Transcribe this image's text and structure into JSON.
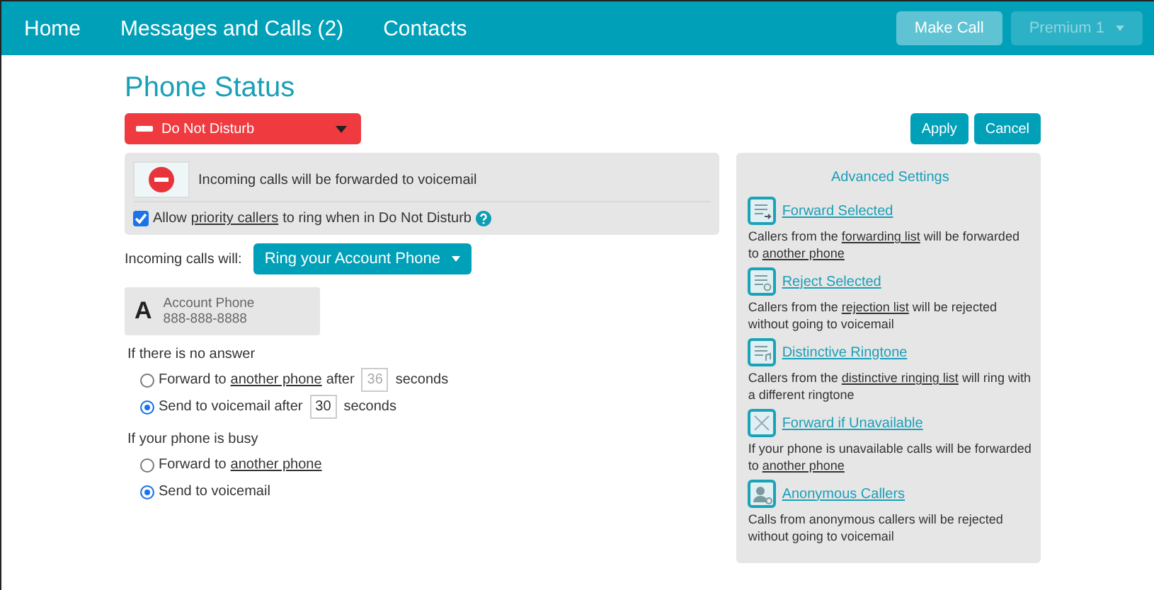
{
  "nav": {
    "items": [
      {
        "label": "Home"
      },
      {
        "label": "Messages and Calls (2)"
      },
      {
        "label": "Contacts"
      }
    ],
    "buttons": [
      {
        "label": "Make Call",
        "disabled": false,
        "caret": false
      },
      {
        "label": "Premium 1",
        "disabled": true,
        "caret": true
      }
    ]
  },
  "title": "Phone Status",
  "status_dropdown": {
    "label": "Do Not Disturb"
  },
  "actions": [
    "Apply",
    "Cancel"
  ],
  "status_card": {
    "message": "Incoming calls will be forwarded to voicemail",
    "priority": {
      "checked": true,
      "parts": [
        {
          "kind": "text",
          "text": "Allow"
        },
        {
          "kind": "link",
          "text": "priority callers"
        },
        {
          "kind": "text",
          "text": "to ring when in Do Not Disturb"
        }
      ]
    }
  },
  "incoming": {
    "label": "Incoming calls will:",
    "value": "Ring your Account Phone"
  },
  "phone": {
    "letter": "A",
    "name": "Account Phone",
    "number": "888-888-8888"
  },
  "groups": [
    {
      "title": "If there is no answer",
      "options": [
        {
          "selected": false,
          "parts": [
            {
              "kind": "text",
              "text": "Forward to"
            },
            {
              "kind": "link",
              "text": "another phone"
            },
            {
              "kind": "text",
              "text": "after"
            }
          ],
          "field": {
            "value": "36",
            "disabled": true
          },
          "suffix": "seconds"
        },
        {
          "selected": true,
          "parts": [
            {
              "kind": "text",
              "text": "Send to voicemail after"
            }
          ],
          "field": {
            "value": "30",
            "disabled": false
          },
          "suffix": "seconds"
        }
      ]
    },
    {
      "title": "If your phone is busy",
      "options": [
        {
          "selected": false,
          "parts": [
            {
              "kind": "text",
              "text": "Forward to"
            },
            {
              "kind": "link",
              "text": "another phone"
            }
          ]
        },
        {
          "selected": true,
          "parts": [
            {
              "kind": "text",
              "text": "Send to voicemail"
            }
          ]
        }
      ]
    }
  ],
  "advanced": {
    "title": "Advanced Settings",
    "items": [
      {
        "kind": "forward",
        "label": "Forward Selected",
        "desc": [
          {
            "kind": "text",
            "text": "Callers from the"
          },
          {
            "kind": "link",
            "text": "forwarding list"
          },
          {
            "kind": "text",
            "text": "will be forwarded to"
          },
          {
            "kind": "link",
            "text": "another phone"
          }
        ]
      },
      {
        "kind": "reject",
        "label": "Reject Selected",
        "desc": [
          {
            "kind": "text",
            "text": "Callers from the"
          },
          {
            "kind": "link",
            "text": "rejection list"
          },
          {
            "kind": "text",
            "text": "will be rejected without going to voicemail"
          }
        ]
      },
      {
        "kind": "ringtone",
        "label": "Distinctive Ringtone",
        "desc": [
          {
            "kind": "text",
            "text": "Callers from the"
          },
          {
            "kind": "link",
            "text": "distinctive ringing list"
          },
          {
            "kind": "text",
            "text": "will ring with a different ringtone"
          }
        ]
      },
      {
        "kind": "unavailable",
        "label": "Forward if Unavailable",
        "desc": [
          {
            "kind": "text",
            "text": "If your phone is unavailable calls will be forwarded to"
          },
          {
            "kind": "link",
            "text": "another phone"
          }
        ]
      },
      {
        "kind": "anonymous",
        "label": "Anonymous Callers",
        "desc": [
          {
            "kind": "text",
            "text": "Calls from anonymous callers will be rejected without going to voicemail"
          }
        ]
      }
    ]
  }
}
